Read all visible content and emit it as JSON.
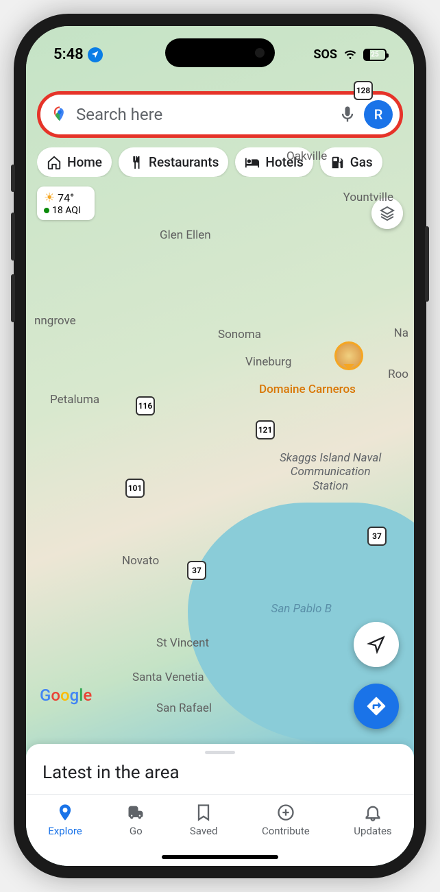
{
  "status_bar": {
    "time": "5:48",
    "sos": "SOS",
    "battery_pct": 25
  },
  "search": {
    "placeholder": "Search here",
    "avatar_initial": "R"
  },
  "chips": [
    {
      "label": "Home",
      "icon": "home-icon"
    },
    {
      "label": "Restaurants",
      "icon": "restaurant-icon"
    },
    {
      "label": "Hotels",
      "icon": "hotel-icon"
    },
    {
      "label": "Gas",
      "icon": "gas-icon"
    }
  ],
  "weather": {
    "temp": "74°",
    "aqi": "18 AQI"
  },
  "map_labels": {
    "oakville": "Oakville",
    "yountville": "Yountville",
    "glen_ellen": "Glen Ellen",
    "nngrove": "nngrove",
    "sonoma": "Sonoma",
    "vineburg": "Vineburg",
    "na": "Na",
    "roo": "Roo",
    "petaluma": "Petaluma",
    "domaine": "Domaine Carneros",
    "skaggs": "Skaggs Island Naval\nCommunication\nStation",
    "novato": "Novato",
    "st_vincent": "St Vincent",
    "santa_venetia": "Santa Venetia",
    "san_rafael": "San Rafael",
    "san_pablo": "San Pablo B"
  },
  "routes": {
    "r128": "128",
    "r116": "116",
    "r121": "121",
    "r101": "101",
    "r37a": "37",
    "r37b": "37"
  },
  "sheet": {
    "title": "Latest in the area"
  },
  "bottom_nav": [
    {
      "label": "Explore",
      "icon": "explore-icon",
      "active": true
    },
    {
      "label": "Go",
      "icon": "go-icon",
      "active": false
    },
    {
      "label": "Saved",
      "icon": "saved-icon",
      "active": false
    },
    {
      "label": "Contribute",
      "icon": "contribute-icon",
      "active": false
    },
    {
      "label": "Updates",
      "icon": "updates-icon",
      "active": false
    }
  ],
  "google_logo": "Google",
  "annotation": {
    "search_highlight_color": "#e63329"
  }
}
